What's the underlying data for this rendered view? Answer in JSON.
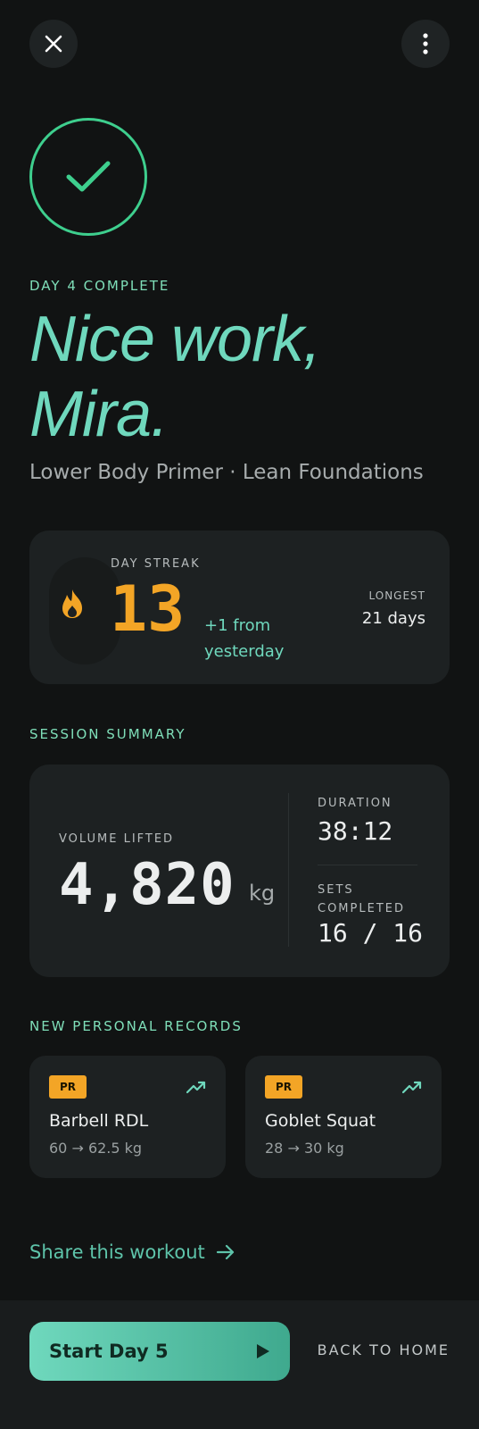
{
  "header": {
    "close_icon": "close-icon",
    "more_icon": "more-vertical-icon"
  },
  "hero": {
    "check_icon": "checkmark-icon",
    "day_label": "DAY 4 COMPLETE",
    "headline_line1": "Nice work,",
    "headline_line2": "Mira.",
    "subtitle": "Lower Body Primer · Lean Foundations"
  },
  "streak": {
    "icon": "flame-icon",
    "label": "DAY STREAK",
    "value": "13",
    "delta_line1": "+1 from",
    "delta_line2": "yesterday",
    "longest_label": "LONGEST",
    "longest_value": "21 days"
  },
  "summary": {
    "section_label": "SESSION SUMMARY",
    "volume_label": "VOLUME LIFTED",
    "volume_value": "4,820",
    "volume_unit": "kg",
    "duration_label": "DURATION",
    "duration_value": "38:12",
    "sets_label": "SETS COMPLETED",
    "sets_value": "16 / 16"
  },
  "records": {
    "section_label": "NEW PERSONAL RECORDS",
    "items": [
      {
        "badge": "PR",
        "name": "Barbell RDL",
        "delta": "60 → 62.5 kg",
        "icon": "trending-up-icon"
      },
      {
        "badge": "PR",
        "name": "Goblet Squat",
        "delta": "28 → 30 kg",
        "icon": "trending-up-icon"
      }
    ]
  },
  "share": {
    "label": "Share this workout",
    "icon": "arrow-right-icon"
  },
  "footer": {
    "start_label": "Start Day 5",
    "start_icon": "play-icon",
    "back_label": "BACK TO HOME"
  },
  "colors": {
    "background": "#111313",
    "accent": "#6fd8bd",
    "success": "#3ecf8e",
    "streak": "#f3a526",
    "card": "#1d2122"
  }
}
